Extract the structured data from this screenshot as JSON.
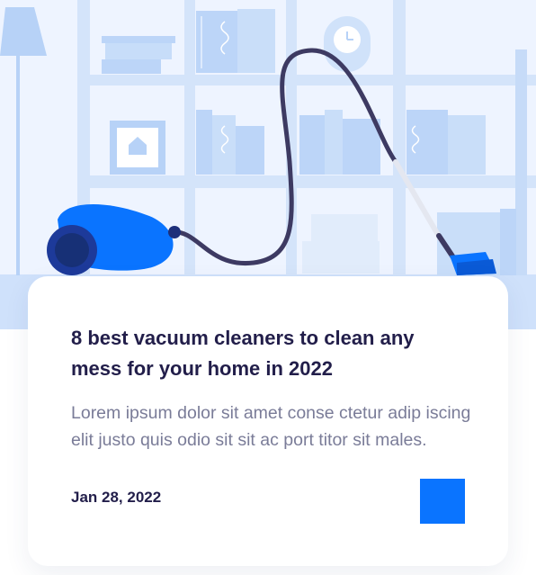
{
  "colors": {
    "accent": "#0a74ff",
    "title": "#221e4a",
    "excerpt": "#7a7c98",
    "hero_background": "#eef4ff"
  },
  "hero": {
    "illustration": "vacuum-cleaner-in-room"
  },
  "card": {
    "title": "8 best vacuum cleaners to clean any mess for your home in 2022",
    "excerpt": "Lorem ipsum dolor sit amet conse ctetur adip iscing elit justo quis odio sit sit ac port titor sit males.",
    "date": "Jan 28, 2022",
    "action_icon": "square-button"
  }
}
